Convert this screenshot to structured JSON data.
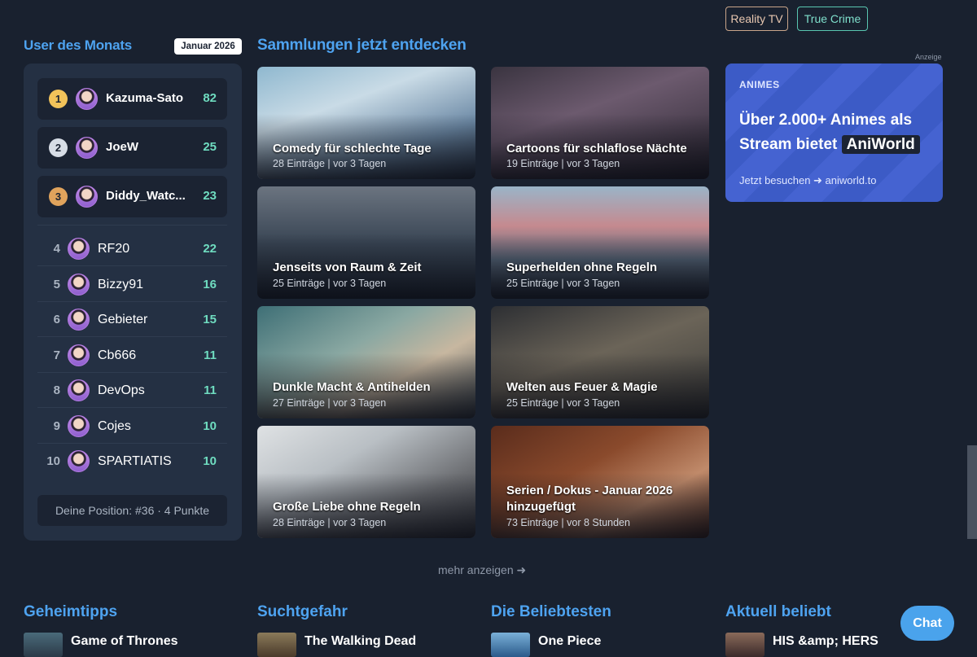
{
  "tags": [
    "Reality TV",
    "True Crime"
  ],
  "users": {
    "title": "User des Monats",
    "month_badge": "Januar 2026",
    "top": [
      {
        "rank": "1",
        "name": "Kazuma-Sato",
        "points": "82"
      },
      {
        "rank": "2",
        "name": "JoeW",
        "points": "25"
      },
      {
        "rank": "3",
        "name": "Diddy_Watc...",
        "points": "23"
      }
    ],
    "rest": [
      {
        "rank": "4",
        "name": "RF20",
        "points": "22"
      },
      {
        "rank": "5",
        "name": "Bizzy91",
        "points": "16"
      },
      {
        "rank": "6",
        "name": "Gebieter",
        "points": "15"
      },
      {
        "rank": "7",
        "name": "Cb666",
        "points": "11"
      },
      {
        "rank": "8",
        "name": "DevOps",
        "points": "11"
      },
      {
        "rank": "9",
        "name": "Cojes",
        "points": "10"
      },
      {
        "rank": "10",
        "name": "SPARTIATIS",
        "points": "10"
      }
    ],
    "my_position": "Deine Position: #36 · 4 Punkte"
  },
  "collections": {
    "title": "Sammlungen jetzt entdecken",
    "items": [
      {
        "title": "Comedy für schlechte Tage",
        "meta": "28 Einträge | vor 3 Tagen"
      },
      {
        "title": "Cartoons für schlaflose Nächte",
        "meta": "19 Einträge | vor 3 Tagen"
      },
      {
        "title": "Jenseits von Raum & Zeit",
        "meta": "25 Einträge | vor 3 Tagen"
      },
      {
        "title": "Superhelden ohne Regeln",
        "meta": "25 Einträge | vor 3 Tagen"
      },
      {
        "title": "Dunkle Macht & Antihelden",
        "meta": "27 Einträge | vor 3 Tagen"
      },
      {
        "title": "Welten aus Feuer & Magie",
        "meta": "25 Einträge | vor 3 Tagen"
      },
      {
        "title": "Große Liebe ohne Regeln",
        "meta": "28 Einträge | vor 3 Tagen"
      },
      {
        "title": "Serien / Dokus - Januar 2026 hinzugefügt",
        "meta": "73 Einträge | vor 8 Stunden"
      }
    ],
    "more": "mehr anzeigen ➜"
  },
  "ad": {
    "label": "Anzeige",
    "kicker": "ANIMES",
    "headline": "Über 2.000+ Animes als Stream bietet",
    "brand": "AniWorld",
    "cta": "Jetzt besuchen ➜ aniworld.to"
  },
  "footer": [
    {
      "heading": "Geheimtipps",
      "first": "Game of Thrones"
    },
    {
      "heading": "Suchtgefahr",
      "first": "The Walking Dead"
    },
    {
      "heading": "Die Beliebtesten",
      "first": "One Piece"
    },
    {
      "heading": "Aktuell beliebt",
      "first": "HIS &amp; HERS"
    }
  ],
  "chat": "Chat"
}
